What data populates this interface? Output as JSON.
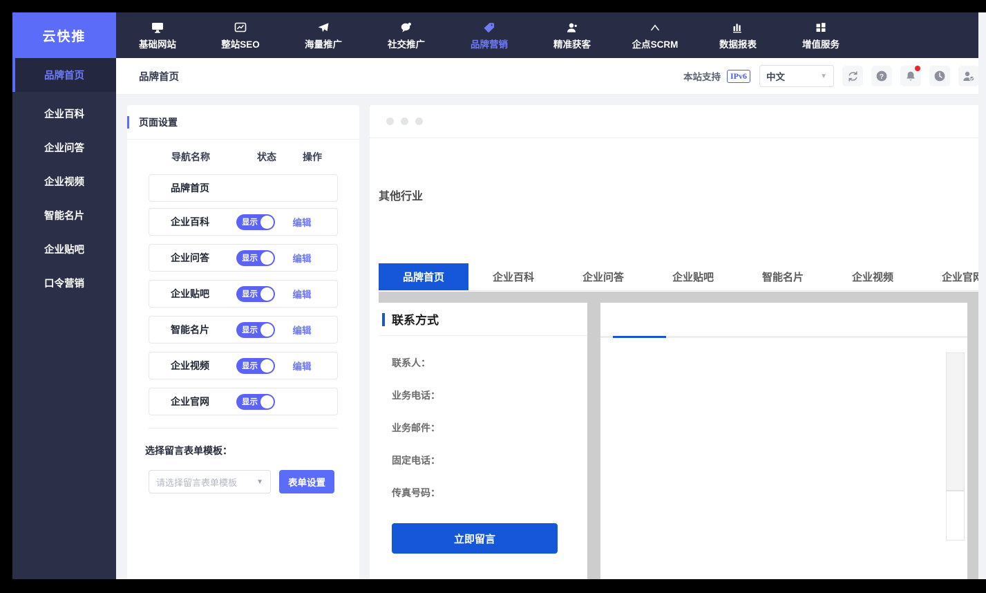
{
  "brand": {
    "name": "云快推"
  },
  "topnav": {
    "items": [
      {
        "label": "基础网站",
        "icon": "monitor-icon",
        "active": false
      },
      {
        "label": "整站SEO",
        "icon": "chart-frame-icon",
        "active": false
      },
      {
        "label": "海量推广",
        "icon": "paper-plane-icon",
        "active": false
      },
      {
        "label": "社交推广",
        "icon": "chat-bubble-icon",
        "active": false
      },
      {
        "label": "品牌营销",
        "icon": "tag-icon",
        "active": true
      },
      {
        "label": "精准获客",
        "icon": "user-icon",
        "active": false
      },
      {
        "label": "企点SCRM",
        "icon": "chevron-up-icon",
        "active": false
      },
      {
        "label": "数据报表",
        "icon": "bar-chart-icon",
        "active": false
      },
      {
        "label": "增值服务",
        "icon": "grid-icon",
        "active": false
      }
    ]
  },
  "sidebar": {
    "items": [
      {
        "label": "品牌首页",
        "active": true
      },
      {
        "label": "企业百科",
        "active": false
      },
      {
        "label": "企业问答",
        "active": false
      },
      {
        "label": "企业视频",
        "active": false
      },
      {
        "label": "智能名片",
        "active": false
      },
      {
        "label": "企业贴吧",
        "active": false
      },
      {
        "label": "口令营销",
        "active": false
      }
    ]
  },
  "header": {
    "breadcrumb": "品牌首页",
    "support_text": "本站支持",
    "ipv6_badge": "IPv6",
    "language": "中文",
    "caret": "▼",
    "icons": [
      {
        "name": "refresh-icon",
        "badge": false
      },
      {
        "name": "help-icon",
        "badge": false
      },
      {
        "name": "bell-icon",
        "badge": true
      },
      {
        "name": "clock-icon",
        "badge": false
      },
      {
        "name": "user-check-icon",
        "badge": false
      }
    ]
  },
  "settings": {
    "title": "页面设置",
    "columns": {
      "name": "导航名称",
      "state": "状态",
      "op": "操作"
    },
    "rows": [
      {
        "name": "品牌首页",
        "toggle": null,
        "op": ""
      },
      {
        "name": "企业百科",
        "toggle": "显示",
        "op": "编辑"
      },
      {
        "name": "企业问答",
        "toggle": "显示",
        "op": "编辑"
      },
      {
        "name": "企业贴吧",
        "toggle": "显示",
        "op": "编辑"
      },
      {
        "name": "智能名片",
        "toggle": "显示",
        "op": "编辑"
      },
      {
        "name": "企业视频",
        "toggle": "显示",
        "op": "编辑"
      },
      {
        "name": "企业官网",
        "toggle": "显示",
        "op": ""
      }
    ],
    "form_template_label": "选择留言表单模板：",
    "form_template_placeholder": "请选择留言表单模板",
    "form_template_caret": "▼",
    "form_settings_button": "表单设置"
  },
  "preview": {
    "industry": "其他行业",
    "tabs": [
      {
        "label": "品牌首页",
        "active": true
      },
      {
        "label": "企业百科",
        "active": false
      },
      {
        "label": "企业问答",
        "active": false
      },
      {
        "label": "企业贴吧",
        "active": false
      },
      {
        "label": "智能名片",
        "active": false
      },
      {
        "label": "企业视频",
        "active": false
      },
      {
        "label": "企业官网",
        "active": false
      }
    ],
    "contact": {
      "title": "联系方式",
      "fields": [
        "联系人：",
        "业务电话：",
        "业务邮件：",
        "固定电话：",
        "传真号码："
      ],
      "button": "立即留言"
    }
  },
  "colors": {
    "brand_purple": "#5b6cf9",
    "nav_dark": "#282c45",
    "sidebar_dark": "#2b3048",
    "toggle_on": "#5b63f5",
    "preview_blue": "#1557d8",
    "badge_red": "#f5222d"
  }
}
